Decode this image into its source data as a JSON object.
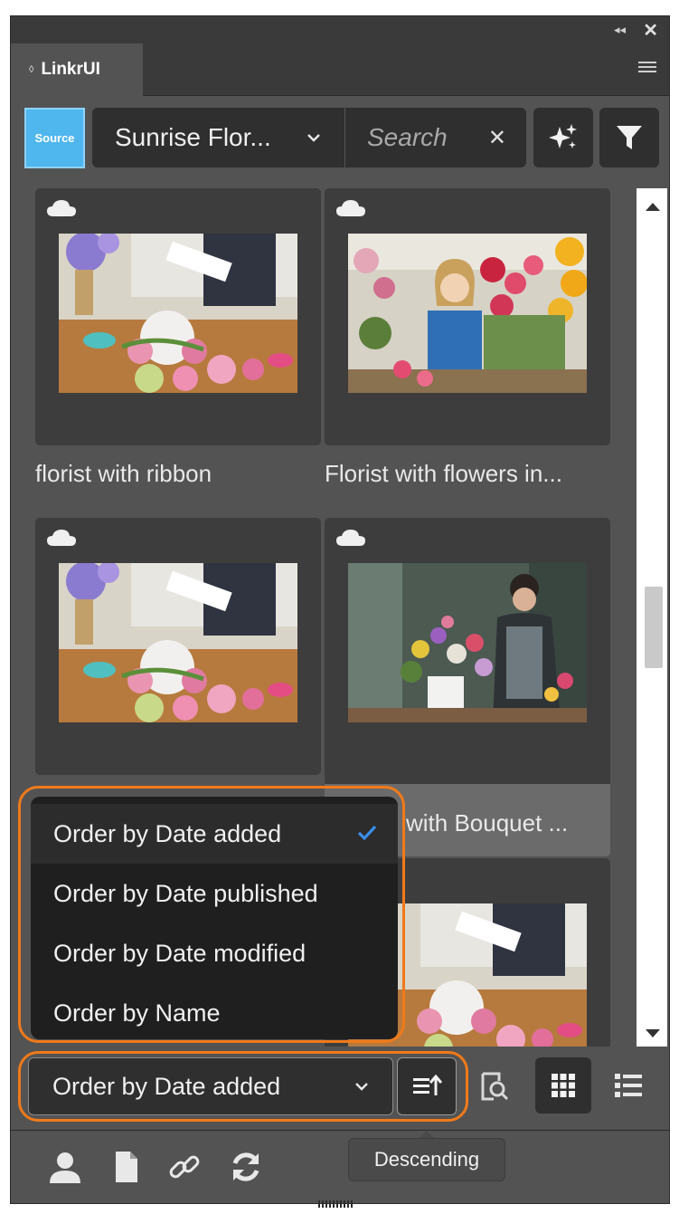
{
  "panel": {
    "tab_label": "LinkrUI",
    "source_label": "Source",
    "source_value": "Sunrise Flor...",
    "search_placeholder": "Search",
    "icons": [
      "collapse-icon",
      "close-icon",
      "panel-menu-icon",
      "chevron-down-icon",
      "clear-icon",
      "sparkle-icon",
      "filter-icon"
    ]
  },
  "assets": [
    {
      "caption": "florist with ribbon",
      "badge": "cloud-icon",
      "image": "florist arranging flowers with pink ribbon on wooden table"
    },
    {
      "caption": "Florist with flowers in...",
      "badge": "cloud-icon",
      "image": "smiling florist in blue apron surrounded by flowers"
    },
    {
      "caption": "",
      "badge": "cloud-icon",
      "image": "florist arranging flowers with pink ribbon on wooden table"
    },
    {
      "caption": "with Bouquet ...",
      "badge": "cloud-icon",
      "image": "florist arranging bouquet in white jug"
    },
    {
      "caption": "",
      "badge": "cloud-icon",
      "image": "florist arranging flowers with pink ribbon on wooden table"
    }
  ],
  "sort": {
    "current": "Order by Date added",
    "options": [
      "Order by Date added",
      "Order by Date published",
      "Order by Date modified",
      "Order by Name"
    ],
    "selected_index": 0,
    "direction_tooltip": "Descending"
  },
  "footer": {
    "icons": [
      "user-icon",
      "document-icon",
      "link-icon",
      "refresh-icon"
    ]
  },
  "colors": {
    "panel_bg": "#535353",
    "card_bg": "#3d3d3d",
    "accent_source": "#4fb6ee",
    "highlight": "#f07a1a",
    "check": "#3b8eea"
  }
}
